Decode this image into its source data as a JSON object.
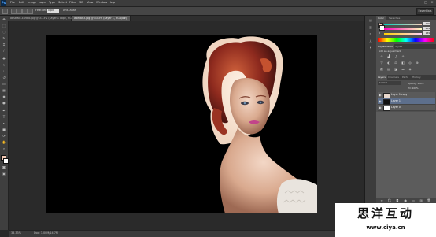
{
  "app": {
    "logo": "Ps"
  },
  "menu": [
    "File",
    "Edit",
    "Image",
    "Layer",
    "Type",
    "Select",
    "Filter",
    "3D",
    "View",
    "Window",
    "Help"
  ],
  "options": {
    "feather_label": "Feather:",
    "feather_value": "0 px",
    "anti_alias": "Anti-alias",
    "workspace": "Essentials"
  },
  "tabs": [
    {
      "title": "abstract-card-b.jpg @ 33.3% (Layer 1 copy, RGB/8#)"
    },
    {
      "title": "woman3.jpg @ 33.3% (Layer 1, RGB/8#)"
    }
  ],
  "status": {
    "zoom": "33.33%",
    "doc": "Doc: 3.00M/14.7M"
  },
  "panels": {
    "color_tabs": [
      "Color",
      "Swatches"
    ],
    "sliders": [
      {
        "label": "R",
        "value": "255"
      },
      {
        "label": "G",
        "value": "209"
      },
      {
        "label": "B",
        "value": "189"
      }
    ],
    "adjust_tabs": [
      "Adjustments",
      "Styles"
    ],
    "adjust_title": "Add an adjustment",
    "layers_tabs": [
      "Layers",
      "Channels",
      "Paths",
      "History"
    ],
    "blend_mode": "Normal",
    "opacity": "Opacity: 100%",
    "fill": "Fill: 100%",
    "layers": [
      {
        "name": "Layer 1 copy",
        "selected": false
      },
      {
        "name": "Layer 1",
        "selected": true
      },
      {
        "name": "Layer 0",
        "selected": false
      }
    ]
  },
  "colors": {
    "foreground": "#f2c8b4",
    "background": "#ffffff",
    "accent_selection": "#5d6f8c"
  },
  "watermark": {
    "name": "思洋互动",
    "url": "www.ciya.cn"
  }
}
